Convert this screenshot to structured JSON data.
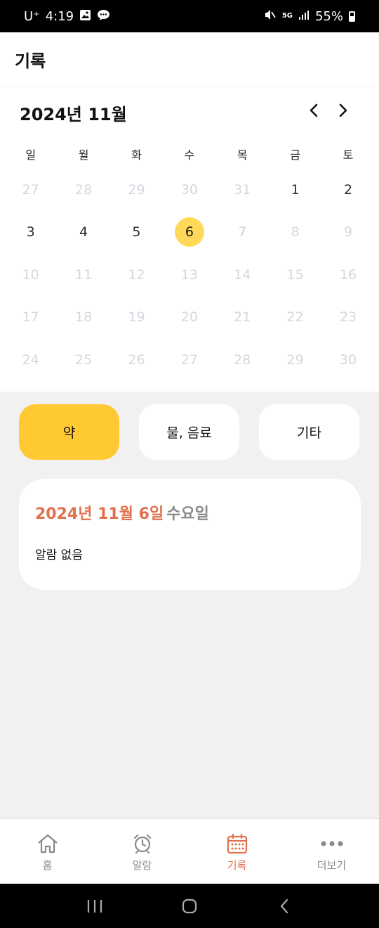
{
  "status_bar": {
    "carrier": "U⁺",
    "time": "4:19",
    "battery": "55%",
    "network": "5G"
  },
  "app_bar": {
    "title": "기록"
  },
  "calendar": {
    "month_title": "2024년 11월",
    "weekdays": [
      "일",
      "월",
      "화",
      "수",
      "목",
      "금",
      "토"
    ],
    "selected_day": "6",
    "weeks": [
      [
        {
          "d": "27",
          "s": "muted"
        },
        {
          "d": "28",
          "s": "muted"
        },
        {
          "d": "29",
          "s": "muted"
        },
        {
          "d": "30",
          "s": "muted"
        },
        {
          "d": "31",
          "s": "muted"
        },
        {
          "d": "1",
          "s": "active"
        },
        {
          "d": "2",
          "s": "active"
        }
      ],
      [
        {
          "d": "3",
          "s": "active"
        },
        {
          "d": "4",
          "s": "active"
        },
        {
          "d": "5",
          "s": "active"
        },
        {
          "d": "6",
          "s": "selected"
        },
        {
          "d": "7",
          "s": "disabled"
        },
        {
          "d": "8",
          "s": "muted"
        },
        {
          "d": "9",
          "s": "muted"
        }
      ],
      [
        {
          "d": "10",
          "s": "muted"
        },
        {
          "d": "11",
          "s": "muted"
        },
        {
          "d": "12",
          "s": "muted"
        },
        {
          "d": "13",
          "s": "muted"
        },
        {
          "d": "14",
          "s": "muted"
        },
        {
          "d": "15",
          "s": "muted"
        },
        {
          "d": "16",
          "s": "muted"
        }
      ],
      [
        {
          "d": "17",
          "s": "muted"
        },
        {
          "d": "18",
          "s": "muted"
        },
        {
          "d": "19",
          "s": "muted"
        },
        {
          "d": "20",
          "s": "muted"
        },
        {
          "d": "21",
          "s": "muted"
        },
        {
          "d": "22",
          "s": "muted"
        },
        {
          "d": "23",
          "s": "muted"
        }
      ],
      [
        {
          "d": "24",
          "s": "muted"
        },
        {
          "d": "25",
          "s": "muted"
        },
        {
          "d": "26",
          "s": "muted"
        },
        {
          "d": "27",
          "s": "muted"
        },
        {
          "d": "28",
          "s": "muted"
        },
        {
          "d": "29",
          "s": "muted"
        },
        {
          "d": "30",
          "s": "muted"
        }
      ]
    ]
  },
  "tabs": [
    {
      "label": "약",
      "active": true
    },
    {
      "label": "물, 음료",
      "active": false
    },
    {
      "label": "기타",
      "active": false
    }
  ],
  "card": {
    "date": "2024년 11월 6일",
    "weekday": "수요일",
    "empty_text": "알람 없음"
  },
  "bottom_nav": [
    {
      "label": "홈",
      "icon": "home-icon",
      "active": false
    },
    {
      "label": "알람",
      "icon": "alarm-clock-icon",
      "active": false
    },
    {
      "label": "기록",
      "icon": "calendar-icon",
      "active": true
    },
    {
      "label": "더보기",
      "icon": "more-dots-icon",
      "active": false
    }
  ],
  "colors": {
    "accent": "#e2704c",
    "tab_active": "#ffc934",
    "selected_day": "#ffd95a",
    "background": "#f1f1f1"
  }
}
